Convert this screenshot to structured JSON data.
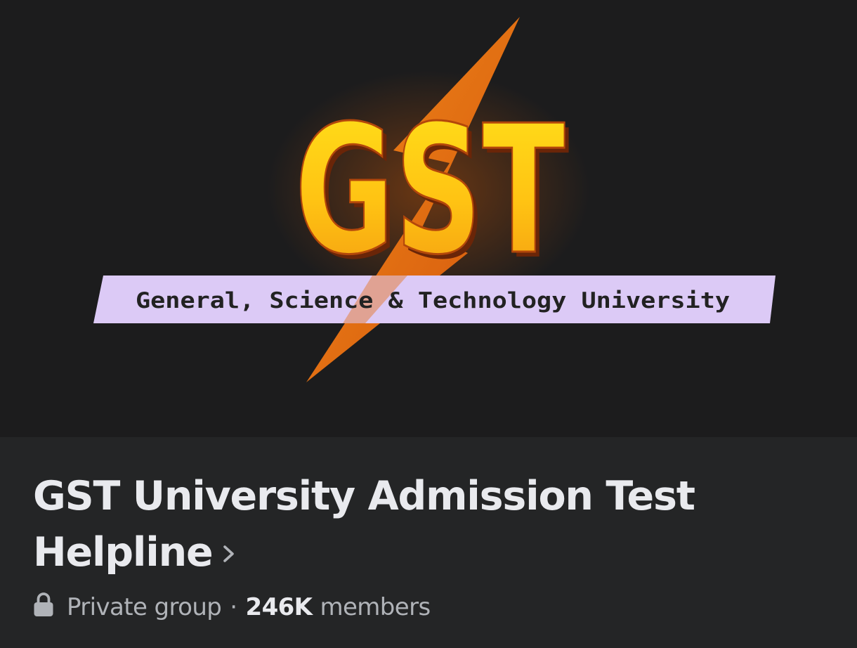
{
  "cover": {
    "logo_letters": "GST",
    "logo_banner": "General, Science & Technology University",
    "colors": {
      "background": "#1c1c1d",
      "bolt": "#e86a12",
      "letters_top": "#ffe21a",
      "letters_bottom": "#f39a10",
      "banner": "#dccaf6",
      "banner_text": "#222222"
    }
  },
  "group": {
    "title": "GST University Admission Test Helpline",
    "privacy": "Private group",
    "separator": "·",
    "member_count": "246K",
    "members_label": "members",
    "icons": {
      "privacy": "lock-icon",
      "open_details": "chevron-right-icon"
    }
  },
  "colors": {
    "info_background": "#242526",
    "title_text": "#e9eaee",
    "secondary_text": "#b0b3b8"
  }
}
